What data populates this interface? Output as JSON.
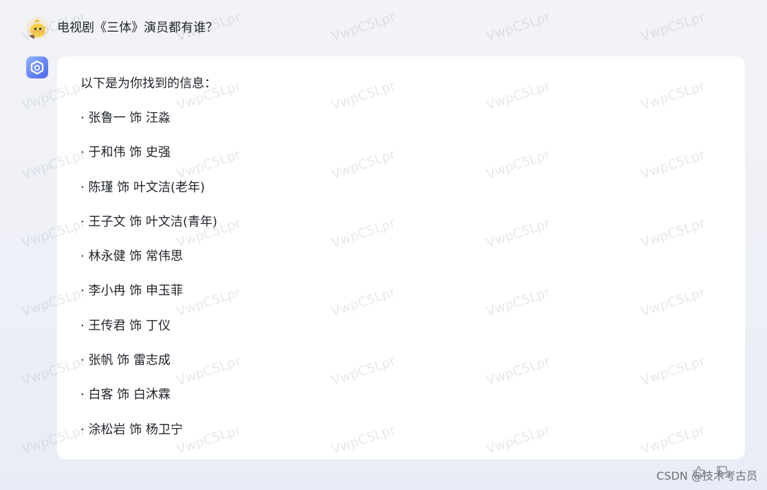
{
  "conversation": {
    "user": {
      "question": "电视剧《三体》演员都有谁？"
    },
    "assistant": {
      "intro": "以下是为你找到的信息：",
      "cast": [
        "· 张鲁一 饰 汪淼",
        "· 于和伟 饰 史强",
        "· 陈瑾 饰 叶文洁(老年)",
        "· 王子文 饰 叶文洁(青年)",
        "· 林永健 饰 常伟思",
        "· 李小冉 饰 申玉菲",
        "· 王传君 饰 丁仪",
        "· 张帆 饰 雷志成",
        "· 白客 饰 白沐霖",
        "· 涂松岩 饰 杨卫宁"
      ]
    }
  },
  "actions": {
    "icons": [
      "thumbs-up-icon",
      "thumbs-down-icon"
    ]
  },
  "watermark": {
    "text": "VwpC5Lpr"
  },
  "credit": "CSDN @技术考古员",
  "colors": {
    "background": "#eef0f7",
    "card": "#ffffff",
    "text": "#1f2329",
    "bot_gradient_start": "#7fa8ff",
    "bot_gradient_end": "#4a6cf7"
  }
}
